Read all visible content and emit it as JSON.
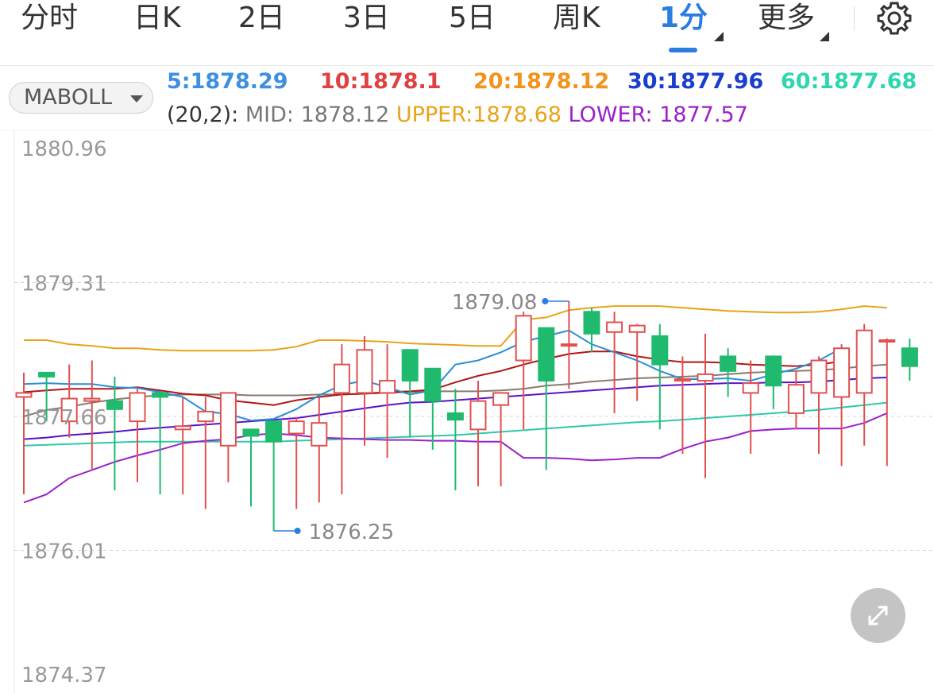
{
  "tabs": [
    {
      "label": "分时"
    },
    {
      "label": "日K"
    },
    {
      "label": "2日"
    },
    {
      "label": "3日"
    },
    {
      "label": "5日"
    },
    {
      "label": "周K"
    },
    {
      "label": "1分",
      "active": true
    },
    {
      "label": "更多"
    }
  ],
  "indicator": {
    "selector_label": "MABOLL",
    "ma": [
      {
        "text": "5:1878.29",
        "color": "#3d8fe0"
      },
      {
        "text": "10:1878.1",
        "color": "#e04040"
      },
      {
        "text": "20:1878.12",
        "color": "#f2931e"
      },
      {
        "text": "30:1877.96",
        "color": "#1a3fcc"
      },
      {
        "text": "60:1877.68",
        "color": "#2ed6b0"
      }
    ],
    "boll": {
      "params": "(20,2):",
      "mid": "MID: 1878.12",
      "upper": "UPPER:1878.68",
      "lower": "LOWER: 1877.57",
      "mid_color": "#777777",
      "upper_color": "#e8a317",
      "lower_color": "#9b20c8"
    }
  },
  "chart_data": {
    "type": "candlestick",
    "y_ticks": [
      "1880.96",
      "1879.31",
      "1877.66",
      "1876.01",
      "1874.37"
    ],
    "ylim": [
      1874.37,
      1880.96
    ],
    "max_label": "1879.08",
    "min_label": "1876.25",
    "up_color": "#e05050",
    "down_color": "#1fba6e",
    "candles": [
      {
        "o": 1877.9,
        "h": 1878.2,
        "l": 1876.7,
        "c": 1877.95
      },
      {
        "o": 1878.2,
        "h": 1878.2,
        "l": 1877.6,
        "c": 1878.15
      },
      {
        "o": 1877.6,
        "h": 1878.3,
        "l": 1877.4,
        "c": 1877.88
      },
      {
        "o": 1877.85,
        "h": 1878.35,
        "l": 1877.0,
        "c": 1877.88
      },
      {
        "o": 1877.85,
        "h": 1878.15,
        "l": 1876.75,
        "c": 1877.75
      },
      {
        "o": 1877.6,
        "h": 1878.0,
        "l": 1876.85,
        "c": 1877.95
      },
      {
        "o": 1877.95,
        "h": 1877.95,
        "l": 1876.7,
        "c": 1877.9
      },
      {
        "o": 1877.5,
        "h": 1877.9,
        "l": 1876.7,
        "c": 1877.54
      },
      {
        "o": 1877.6,
        "h": 1877.9,
        "l": 1876.52,
        "c": 1877.72
      },
      {
        "o": 1877.3,
        "h": 1877.7,
        "l": 1876.85,
        "c": 1877.95
      },
      {
        "o": 1877.5,
        "h": 1877.5,
        "l": 1876.55,
        "c": 1877.42
      },
      {
        "o": 1877.6,
        "h": 1877.6,
        "l": 1876.25,
        "c": 1877.35
      },
      {
        "o": 1877.45,
        "h": 1877.65,
        "l": 1876.52,
        "c": 1877.6
      },
      {
        "o": 1877.3,
        "h": 1877.9,
        "l": 1876.6,
        "c": 1877.58
      },
      {
        "o": 1877.95,
        "h": 1878.55,
        "l": 1876.7,
        "c": 1878.3
      },
      {
        "o": 1877.95,
        "h": 1878.65,
        "l": 1877.3,
        "c": 1878.48
      },
      {
        "o": 1877.95,
        "h": 1878.55,
        "l": 1877.15,
        "c": 1878.1
      },
      {
        "o": 1878.48,
        "h": 1878.48,
        "l": 1877.4,
        "c": 1878.1
      },
      {
        "o": 1878.25,
        "h": 1878.25,
        "l": 1877.25,
        "c": 1877.85
      },
      {
        "o": 1877.7,
        "h": 1878.0,
        "l": 1876.75,
        "c": 1877.62
      },
      {
        "o": 1877.5,
        "h": 1878.1,
        "l": 1876.8,
        "c": 1877.85
      },
      {
        "o": 1877.8,
        "h": 1877.95,
        "l": 1876.8,
        "c": 1877.95
      },
      {
        "o": 1878.35,
        "h": 1878.95,
        "l": 1877.5,
        "c": 1878.9
      },
      {
        "o": 1878.75,
        "h": 1878.75,
        "l": 1877.0,
        "c": 1878.1
      },
      {
        "o": 1878.55,
        "h": 1879.08,
        "l": 1878.0,
        "c": 1878.55
      },
      {
        "o": 1878.95,
        "h": 1879.0,
        "l": 1878.45,
        "c": 1878.68
      },
      {
        "o": 1878.7,
        "h": 1878.95,
        "l": 1877.7,
        "c": 1878.82
      },
      {
        "o": 1878.7,
        "h": 1878.8,
        "l": 1877.85,
        "c": 1878.78
      },
      {
        "o": 1878.65,
        "h": 1878.8,
        "l": 1877.5,
        "c": 1878.3
      },
      {
        "o": 1878.1,
        "h": 1878.4,
        "l": 1877.2,
        "c": 1878.12
      },
      {
        "o": 1878.1,
        "h": 1878.68,
        "l": 1876.9,
        "c": 1878.18
      },
      {
        "o": 1878.4,
        "h": 1878.5,
        "l": 1877.9,
        "c": 1878.22
      },
      {
        "o": 1877.95,
        "h": 1878.35,
        "l": 1877.2,
        "c": 1878.07
      },
      {
        "o": 1878.4,
        "h": 1878.4,
        "l": 1877.75,
        "c": 1878.04
      },
      {
        "o": 1877.7,
        "h": 1878.22,
        "l": 1877.5,
        "c": 1878.05
      },
      {
        "o": 1877.95,
        "h": 1878.4,
        "l": 1877.2,
        "c": 1878.35
      },
      {
        "o": 1877.9,
        "h": 1878.55,
        "l": 1877.05,
        "c": 1878.5
      },
      {
        "o": 1877.95,
        "h": 1878.8,
        "l": 1877.3,
        "c": 1878.72
      },
      {
        "o": 1878.6,
        "h": 1878.62,
        "l": 1877.05,
        "c": 1878.6
      },
      {
        "o": 1878.5,
        "h": 1878.62,
        "l": 1878.1,
        "c": 1878.28
      }
    ],
    "ma5": [
      1878.06,
      1878.07,
      1878.06,
      1878.06,
      1878.02,
      1878.01,
      1877.96,
      1877.9,
      1877.72,
      1877.69,
      1877.61,
      1877.63,
      1877.75,
      1877.92,
      1878.05,
      1878.1,
      1878.02,
      1877.93,
      1877.98,
      1878.3,
      1878.35,
      1878.45,
      1878.58,
      1878.65,
      1878.72,
      1878.55,
      1878.45,
      1878.35,
      1878.22,
      1878.12,
      1878.12,
      1878.13,
      1878.1,
      1878.18,
      1878.25,
      1878.35,
      1878.5
    ],
    "ma10": [
      1877.96,
      1877.98,
      1878.0,
      1878.0,
      1878.0,
      1878.02,
      1877.98,
      1877.94,
      1877.92,
      1877.86,
      1877.83,
      1877.8,
      1877.86,
      1877.9,
      1877.93,
      1877.94,
      1877.96,
      1877.97,
      1877.99,
      1878.08,
      1878.16,
      1878.22,
      1878.3,
      1878.37,
      1878.43,
      1878.46,
      1878.46,
      1878.4,
      1878.36,
      1878.33,
      1878.33,
      1878.32,
      1878.3,
      1878.29,
      1878.28,
      1878.3,
      1878.34
    ],
    "upper": [
      1878.6,
      1878.6,
      1878.55,
      1878.53,
      1878.5,
      1878.5,
      1878.48,
      1878.47,
      1878.47,
      1878.47,
      1878.47,
      1878.48,
      1878.52,
      1878.6,
      1878.6,
      1878.59,
      1878.58,
      1878.56,
      1878.55,
      1878.54,
      1878.53,
      1878.53,
      1878.85,
      1878.88,
      1878.97,
      1879.0,
      1879.02,
      1879.02,
      1879.02,
      1879.0,
      1878.98,
      1878.96,
      1878.95,
      1878.94,
      1878.94,
      1878.95,
      1878.98,
      1879.02,
      1879.0
    ],
    "mid": [
      1877.66,
      1877.74,
      1877.78,
      1877.83,
      1877.87,
      1877.9,
      1877.92,
      1877.93,
      1877.93,
      1877.93,
      1877.92,
      1877.92,
      1877.92,
      1877.93,
      1877.93,
      1877.94,
      1877.95,
      1877.96,
      1877.97,
      1877.97,
      1877.97,
      1877.98,
      1878.0,
      1878.04,
      1878.06,
      1878.09,
      1878.11,
      1878.13,
      1878.14,
      1878.15,
      1878.16,
      1878.18,
      1878.2,
      1878.21,
      1878.22,
      1878.23,
      1878.25,
      1878.28,
      1878.3
    ],
    "lower": [
      1876.6,
      1876.7,
      1876.9,
      1877.0,
      1877.1,
      1877.18,
      1877.25,
      1877.33,
      1877.36,
      1877.38,
      1877.43,
      1877.45,
      1877.43,
      1877.4,
      1877.39,
      1877.38,
      1877.37,
      1877.37,
      1877.36,
      1877.36,
      1877.35,
      1877.35,
      1877.15,
      1877.15,
      1877.14,
      1877.12,
      1877.13,
      1877.15,
      1877.15,
      1877.26,
      1877.35,
      1877.4,
      1877.48,
      1877.5,
      1877.51,
      1877.51,
      1877.51,
      1877.58,
      1877.7
    ],
    "ma30": [
      1877.38,
      1877.4,
      1877.43,
      1877.45,
      1877.47,
      1877.5,
      1877.52,
      1877.54,
      1877.56,
      1877.58,
      1877.6,
      1877.62,
      1877.64,
      1877.68,
      1877.72,
      1877.76,
      1877.8,
      1877.83,
      1877.84,
      1877.86,
      1877.88,
      1877.9,
      1877.92,
      1877.94,
      1877.96,
      1877.98,
      1878.0,
      1878.02,
      1878.04,
      1878.05,
      1878.06,
      1878.07,
      1878.07,
      1878.08,
      1878.08,
      1878.09,
      1878.11,
      1878.13,
      1878.14
    ],
    "ma60": [
      1877.3,
      1877.31,
      1877.32,
      1877.33,
      1877.34,
      1877.35,
      1877.35,
      1877.35,
      1877.35,
      1877.35,
      1877.35,
      1877.35,
      1877.36,
      1877.37,
      1877.38,
      1877.39,
      1877.4,
      1877.41,
      1877.42,
      1877.43,
      1877.45,
      1877.47,
      1877.49,
      1877.51,
      1877.53,
      1877.55,
      1877.57,
      1877.59,
      1877.6,
      1877.62,
      1877.64,
      1877.66,
      1877.68,
      1877.7,
      1877.72,
      1877.74,
      1877.77,
      1877.8,
      1877.83
    ]
  }
}
